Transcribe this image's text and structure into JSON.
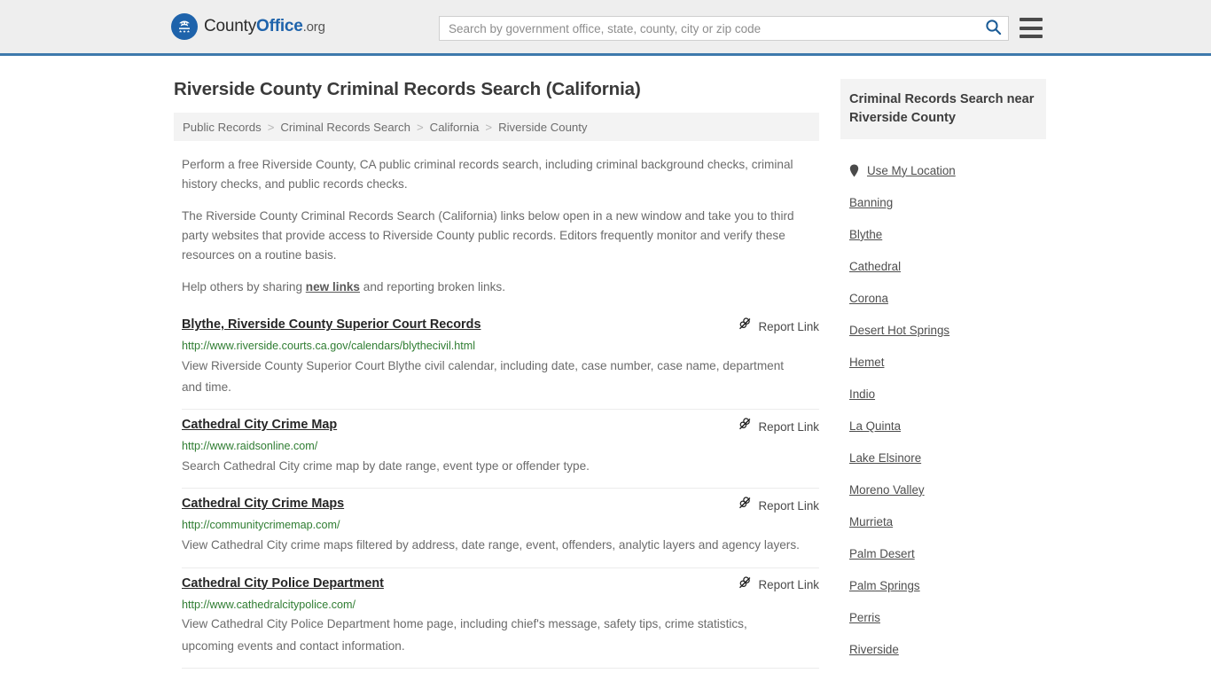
{
  "header": {
    "logo": {
      "icon": "eagle-seal-icon",
      "text_county": "County",
      "text_office": "Office",
      "text_tld": ".org"
    },
    "search": {
      "placeholder": "Search by government office, state, county, city or zip code",
      "value": "",
      "icon": "search-icon"
    },
    "menu_icon": "hamburger-menu-icon",
    "accent_color": "#3e79ac",
    "background_color": "#eeeeee"
  },
  "main": {
    "title": "Riverside County Criminal Records Search (California)",
    "breadcrumb": {
      "separator": ">",
      "items": [
        {
          "label": "Public Records"
        },
        {
          "label": "Criminal Records Search"
        },
        {
          "label": "California"
        },
        {
          "label": "Riverside County"
        }
      ]
    },
    "intro": [
      {
        "prefix": "Perform a free Riverside County, CA public criminal records search, including criminal background checks, criminal history checks, and public records checks.",
        "link": "",
        "suffix": ""
      },
      {
        "prefix": "The Riverside County Criminal Records Search (California) links below open in a new window and take you to third party websites that provide access to Riverside County public records. Editors frequently monitor and verify these resources on a routine basis.",
        "link": "",
        "suffix": ""
      },
      {
        "prefix": "Help others by sharing ",
        "link": "new links",
        "suffix": " and reporting broken links."
      }
    ],
    "report_link_label": "Report Link",
    "report_link_icon": "broken-link-icon",
    "results": [
      {
        "title": "Blythe, Riverside County Superior Court Records",
        "url": "http://www.riverside.courts.ca.gov/calendars/blythecivil.html",
        "description": "View Riverside County Superior Court Blythe civil calendar, including date, case number, case name, department and time."
      },
      {
        "title": "Cathedral City Crime Map",
        "url": "http://www.raidsonline.com/",
        "description": "Search Cathedral City crime map by date range, event type or offender type."
      },
      {
        "title": "Cathedral City Crime Maps",
        "url": "http://communitycrimemap.com/",
        "description": "View Cathedral City crime maps filtered by address, date range, event, offenders, analytic layers and agency layers."
      },
      {
        "title": "Cathedral City Police Department",
        "url": "http://www.cathedralcitypolice.com/",
        "description": "View Cathedral City Police Department home page, including chief's message, safety tips, crime statistics, upcoming events and contact information."
      }
    ]
  },
  "sidebar": {
    "heading": "Criminal Records Search near Riverside County",
    "use_my_location": {
      "label": "Use My Location",
      "icon": "location-pin-icon"
    },
    "cities": [
      {
        "label": "Banning"
      },
      {
        "label": "Blythe"
      },
      {
        "label": "Cathedral"
      },
      {
        "label": "Corona"
      },
      {
        "label": "Desert Hot Springs"
      },
      {
        "label": "Hemet"
      },
      {
        "label": "Indio"
      },
      {
        "label": "La Quinta"
      },
      {
        "label": "Lake Elsinore"
      },
      {
        "label": "Moreno Valley"
      },
      {
        "label": "Murrieta"
      },
      {
        "label": "Palm Desert"
      },
      {
        "label": "Palm Springs"
      },
      {
        "label": "Perris"
      },
      {
        "label": "Riverside"
      }
    ]
  }
}
